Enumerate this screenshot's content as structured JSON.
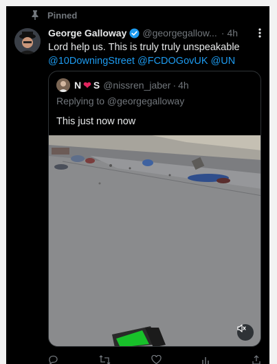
{
  "pinned": {
    "label": "Pinned"
  },
  "tweet": {
    "author": "George Galloway",
    "handle": "@georgegallow...",
    "separator": "·",
    "time": "4h",
    "text_main": "Lord help us. This is truly truly unspeakable",
    "mentions": [
      "@10DowningStreet",
      "@FCDOGovUK",
      "@UN"
    ]
  },
  "quote": {
    "name_start": "N",
    "name_end": "S",
    "handle": "@nissren_jaber",
    "separator": "·",
    "time": "4h",
    "reply_text": "Replying to @georgegalloway",
    "text": "This just now now"
  },
  "icons": {
    "pin": "pin-icon",
    "verified": "verified-badge-icon",
    "more": "more-options-icon",
    "heart": "heart-emoji",
    "mute": "volume-muted-icon"
  },
  "colors": {
    "background": "#000000",
    "primary_text": "#e7e9ea",
    "secondary_text": "#71767b",
    "link": "#1d9bf0",
    "verified": "#1d9bf0",
    "heart": "#e0245e"
  }
}
